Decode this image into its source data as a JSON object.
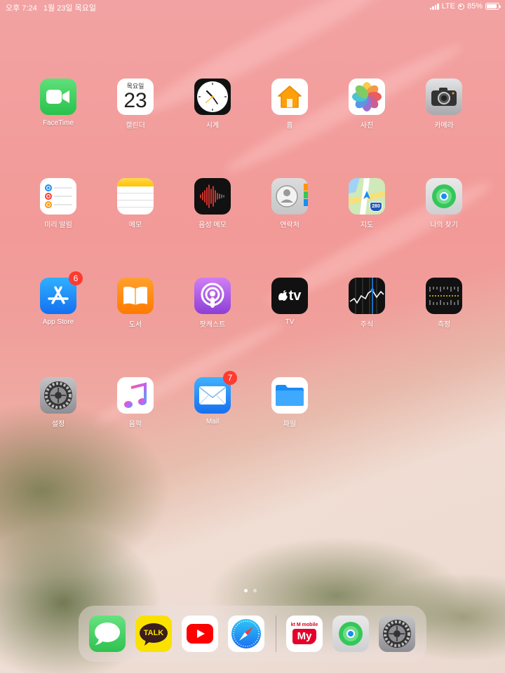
{
  "status_bar": {
    "time": "오후 7:24",
    "date": "1월 23일 목요일",
    "network": "LTE",
    "battery": "85%",
    "battery_level": 0.85
  },
  "apps": [
    {
      "name": "facetime",
      "label": "FaceTime",
      "icon": "video-camera-icon"
    },
    {
      "name": "calendar",
      "label": "캘린더",
      "icon": "calendar-icon",
      "weekday": "목요일",
      "day": "23"
    },
    {
      "name": "clock",
      "label": "시계",
      "icon": "clock-icon"
    },
    {
      "name": "home",
      "label": "홈",
      "icon": "house-icon"
    },
    {
      "name": "photos",
      "label": "사진",
      "icon": "flower-icon"
    },
    {
      "name": "camera",
      "label": "카메라",
      "icon": "camera-icon"
    },
    {
      "name": "reminders",
      "label": "미리 알림",
      "icon": "reminders-icon"
    },
    {
      "name": "notes",
      "label": "메모",
      "icon": "notes-icon"
    },
    {
      "name": "voice-memos",
      "label": "음성 메모",
      "icon": "waveform-icon"
    },
    {
      "name": "contacts",
      "label": "연락처",
      "icon": "person-icon"
    },
    {
      "name": "maps",
      "label": "지도",
      "icon": "map-icon",
      "shield": "280"
    },
    {
      "name": "find-my",
      "label": "나의 찾기",
      "icon": "find-my-icon"
    },
    {
      "name": "app-store",
      "label": "App Store",
      "icon": "app-store-icon",
      "badge": "6"
    },
    {
      "name": "books",
      "label": "도서",
      "icon": "book-icon"
    },
    {
      "name": "podcasts",
      "label": "팟캐스트",
      "icon": "podcast-icon"
    },
    {
      "name": "tv",
      "label": "TV",
      "icon": "apple-tv-icon",
      "icon_text": "tv"
    },
    {
      "name": "stocks",
      "label": "주식",
      "icon": "stocks-icon"
    },
    {
      "name": "measure",
      "label": "측정",
      "icon": "ruler-icon"
    },
    {
      "name": "settings",
      "label": "설정",
      "icon": "gear-icon"
    },
    {
      "name": "music",
      "label": "음악",
      "icon": "music-note-icon"
    },
    {
      "name": "mail",
      "label": "Mail",
      "icon": "envelope-icon",
      "badge": "7"
    },
    {
      "name": "files",
      "label": "파일",
      "icon": "folder-icon"
    }
  ],
  "page_dots": {
    "count": 2,
    "active": 0
  },
  "dock": [
    {
      "name": "messages",
      "icon": "speech-bubble-icon"
    },
    {
      "name": "kakaotalk",
      "icon": "kakaotalk-icon",
      "icon_text": "TALK"
    },
    {
      "name": "youtube",
      "icon": "play-icon"
    },
    {
      "name": "safari",
      "icon": "compass-icon"
    },
    {
      "name": "kt-m-mobile",
      "icon": "kt-m-mobile-icon",
      "icon_text_top": "kt M mobile",
      "icon_text": "My"
    },
    {
      "name": "find-my",
      "icon": "find-my-icon"
    },
    {
      "name": "settings",
      "icon": "gear-icon"
    }
  ],
  "colors": {
    "badge": "#ff3b30",
    "facetime": "#33c759",
    "home": "#ff9f0a",
    "books": "#ff8a00",
    "podcasts": "#b35ee8",
    "app_store": "#1a8cf5",
    "mail": "#1e88f5"
  }
}
